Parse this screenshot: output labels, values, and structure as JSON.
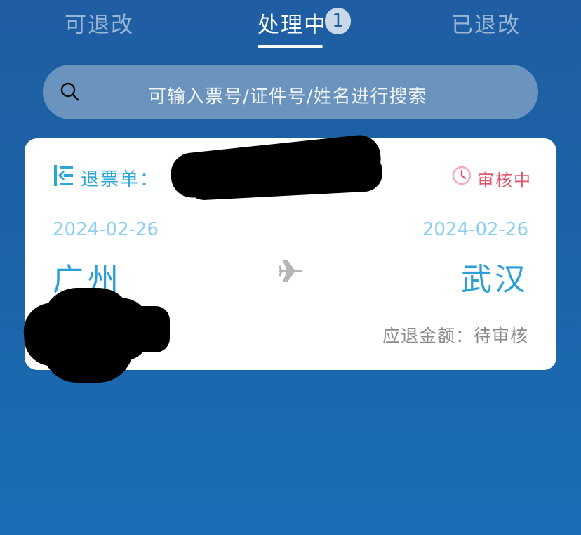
{
  "tabs": {
    "refundable": "可退改",
    "processing": "处理中",
    "processing_count": "1",
    "refunded": "已退改"
  },
  "search": {
    "placeholder": "可输入票号/证件号/姓名进行搜索"
  },
  "card": {
    "ticket_label": "退票单：",
    "status": "审核中",
    "depart_date": "2024-02-26",
    "arrive_date": "2024-02-26",
    "origin": "广州",
    "destination": "武汉",
    "refund_amount": "应退金额：待审核"
  },
  "colors": {
    "accent": "#29a5da",
    "status": "#e0566c",
    "date": "#8acff0",
    "background": "#1f5ea3"
  },
  "icons": [
    "search-icon",
    "ticket-list-icon",
    "clock-icon",
    "plane-icon"
  ]
}
